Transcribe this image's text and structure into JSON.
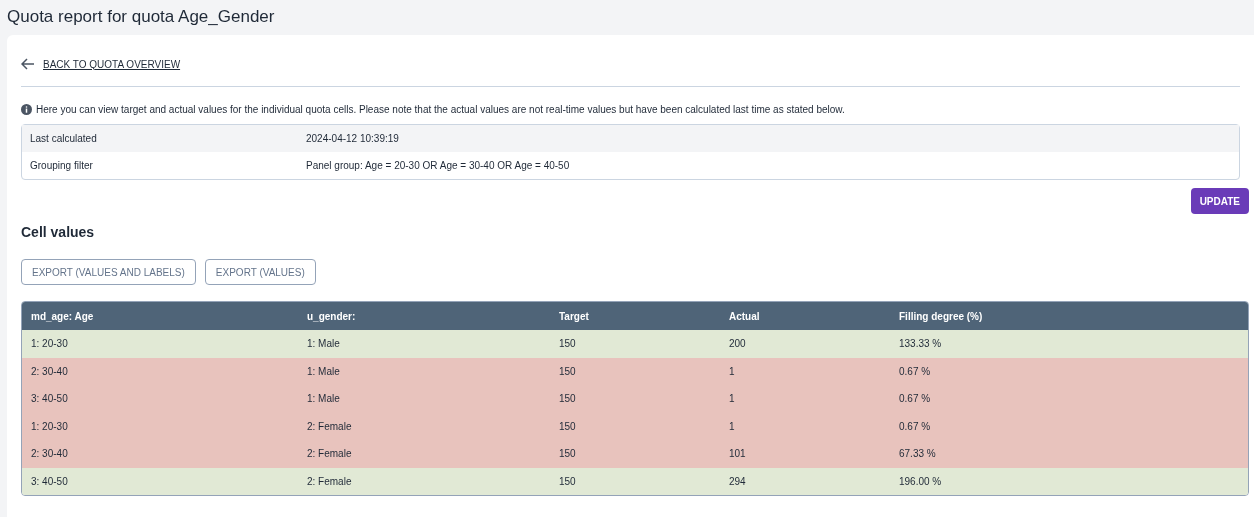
{
  "page_title": "Quota report for quota Age_Gender",
  "back_link": "BACK TO QUOTA OVERVIEW",
  "info_text": "Here you can view target and actual values for the individual quota cells. Please note that the actual values are not real-time values but have been calculated last time as stated below.",
  "details": [
    {
      "label": "Last calculated",
      "value": "2024-04-12 10:39:19"
    },
    {
      "label": "Grouping filter",
      "value": "Panel group: Age = 20-30 OR Age = 30-40 OR Age = 40-50"
    }
  ],
  "update_button": "UPDATE",
  "section_title": "Cell values",
  "export_buttons": [
    "EXPORT (VALUES AND LABELS)",
    "EXPORT (VALUES)"
  ],
  "table": {
    "columns": [
      "md_age: Age",
      "u_gender:",
      "Target",
      "Actual",
      "Filling degree (%)"
    ],
    "rows": [
      {
        "kind": "reached",
        "cells": [
          "1: 20-30",
          "1: Male",
          "150",
          "200",
          "133.33 %"
        ]
      },
      {
        "kind": "short",
        "cells": [
          "2: 30-40",
          "1: Male",
          "150",
          "1",
          "0.67 %"
        ]
      },
      {
        "kind": "short",
        "cells": [
          "3: 40-50",
          "1: Male",
          "150",
          "1",
          "0.67 %"
        ]
      },
      {
        "kind": "short",
        "cells": [
          "1: 20-30",
          "2: Female",
          "150",
          "1",
          "0.67 %"
        ]
      },
      {
        "kind": "short",
        "cells": [
          "2: 30-40",
          "2: Female",
          "150",
          "101",
          "67.33 %"
        ]
      },
      {
        "kind": "reached",
        "cells": [
          "3: 40-50",
          "2: Female",
          "150",
          "294",
          "196.00 %"
        ]
      }
    ]
  }
}
